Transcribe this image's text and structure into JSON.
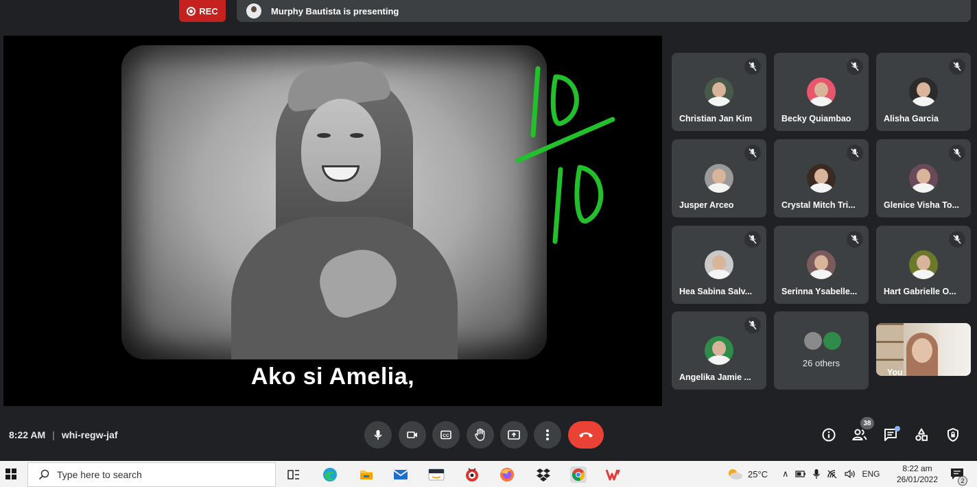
{
  "top": {
    "rec_label": "REC",
    "presenting_text": "Murphy Bautista is presenting"
  },
  "stage": {
    "caption": "Ako si Amelia,",
    "annotation": "10/10 (handwritten in green)",
    "annotation_color": "#22c02a"
  },
  "participants": [
    {
      "name": "Christian Jan Kim",
      "muted": true
    },
    {
      "name": "Becky Quiambao",
      "muted": true
    },
    {
      "name": "Alisha Garcia",
      "muted": true
    },
    {
      "name": "Jusper Arceo",
      "muted": true
    },
    {
      "name": "Crystal Mitch Tri...",
      "muted": true
    },
    {
      "name": "Glenice Visha To...",
      "muted": true
    },
    {
      "name": "Hea Sabina Salv...",
      "muted": true
    },
    {
      "name": "Serinna Ysabelle...",
      "muted": true
    },
    {
      "name": "Hart Gabrielle O...",
      "muted": true
    },
    {
      "name": "Angelika Jamie ...",
      "muted": true
    }
  ],
  "others_tile": {
    "label": "26 others"
  },
  "self_tile": {
    "label": "You"
  },
  "controls": {
    "time": "8:22 AM",
    "separator": "|",
    "meeting_code": "whi-regw-jaf",
    "people_count": "38",
    "buttons": [
      "microphone",
      "camera",
      "captions",
      "raise-hand",
      "present",
      "more-options",
      "leave-call"
    ],
    "side_buttons": [
      "meeting-details",
      "people",
      "chat",
      "activities",
      "host-controls"
    ]
  },
  "taskbar": {
    "search_placeholder": "Type here to search",
    "weather": "25°C",
    "language": "ENG",
    "time": "8:22 am",
    "date": "26/01/2022",
    "notification_count": "2"
  },
  "colors": {
    "rec": "#c5221f",
    "end_call": "#ea4335",
    "tile_bg": "#3c4043",
    "meet_bg": "#202124"
  }
}
